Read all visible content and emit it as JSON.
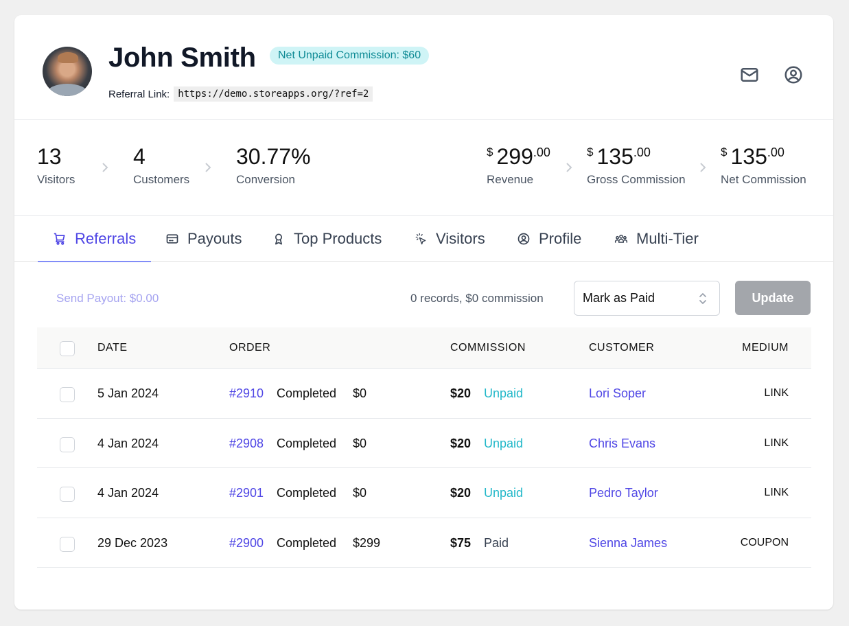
{
  "profile": {
    "name": "John Smith",
    "badge": "Net Unpaid Commission: $60",
    "referral_label": "Referral Link:",
    "referral_link": "https://demo.storeapps.org/?ref=2",
    "icons": [
      "mail-icon",
      "user-circle-icon"
    ]
  },
  "stats": {
    "visitors": {
      "value": "13",
      "label": "Visitors"
    },
    "customers": {
      "value": "4",
      "label": "Customers"
    },
    "conversion": {
      "value": "30.77%",
      "label": "Conversion"
    },
    "revenue": {
      "currency": "$",
      "int": "299",
      "dec": ".00",
      "label": "Revenue"
    },
    "gross_commission": {
      "currency": "$",
      "int": "135",
      "dec": ".00",
      "label": "Gross Commission"
    },
    "net_commission": {
      "currency": "$",
      "int": "135",
      "dec": ".00",
      "label": "Net Commission"
    }
  },
  "tabs": [
    {
      "label": "Referrals",
      "icon": "cart-icon",
      "active": true
    },
    {
      "label": "Payouts",
      "icon": "credit-card-icon",
      "active": false
    },
    {
      "label": "Top Products",
      "icon": "award-icon",
      "active": false
    },
    {
      "label": "Visitors",
      "icon": "cursor-click-icon",
      "active": false
    },
    {
      "label": "Profile",
      "icon": "user-circle-icon",
      "active": false
    },
    {
      "label": "Multi-Tier",
      "icon": "user-group-icon",
      "active": false
    }
  ],
  "colors": {
    "accent": "#4f46e5",
    "unpaid": "#22b8c9",
    "badge_bg": "#cff4f6",
    "badge_text": "#0e8a95"
  },
  "actions": {
    "send_payout": "Send Payout: $0.00",
    "records_summary": "0 records, $0 commission",
    "status_select": "Mark as Paid",
    "update_label": "Update"
  },
  "table": {
    "headers": {
      "date": "DATE",
      "order": "ORDER",
      "commission": "COMMISSION",
      "customer": "CUSTOMER",
      "medium": "MEDIUM"
    },
    "rows": [
      {
        "date": "5 Jan 2024",
        "order_id": "#2910",
        "order_status": "Completed",
        "order_total": "$0",
        "commission": "$20",
        "status": "Unpaid",
        "customer": "Lori Soper",
        "medium": "LINK"
      },
      {
        "date": "4 Jan 2024",
        "order_id": "#2908",
        "order_status": "Completed",
        "order_total": "$0",
        "commission": "$20",
        "status": "Unpaid",
        "customer": "Chris Evans",
        "medium": "LINK"
      },
      {
        "date": "4 Jan 2024",
        "order_id": "#2901",
        "order_status": "Completed",
        "order_total": "$0",
        "commission": "$20",
        "status": "Unpaid",
        "customer": "Pedro Taylor",
        "medium": "LINK"
      },
      {
        "date": "29 Dec 2023",
        "order_id": "#2900",
        "order_status": "Completed",
        "order_total": "$299",
        "commission": "$75",
        "status": "Paid",
        "customer": "Sienna James",
        "medium": "COUPON"
      }
    ]
  }
}
